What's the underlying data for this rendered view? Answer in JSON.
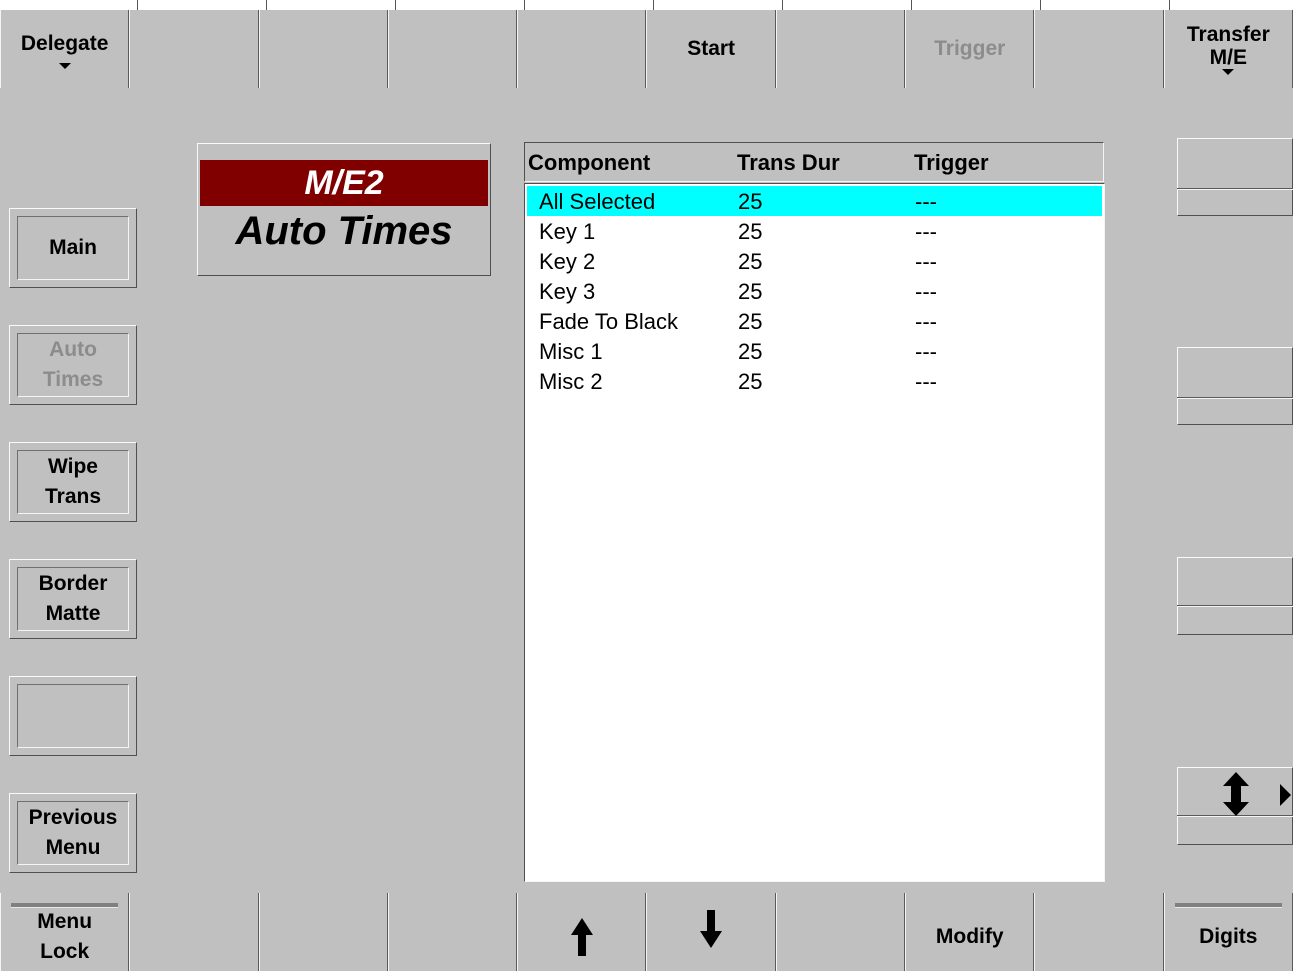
{
  "top_toolbar": [
    {
      "label": "Delegate",
      "label2": "",
      "has_dropdown": true,
      "state": "enabled"
    },
    {
      "label": "",
      "label2": "",
      "has_dropdown": false,
      "state": "enabled"
    },
    {
      "label": "",
      "label2": "",
      "has_dropdown": false,
      "state": "enabled"
    },
    {
      "label": "",
      "label2": "",
      "has_dropdown": false,
      "state": "enabled"
    },
    {
      "label": "",
      "label2": "",
      "has_dropdown": false,
      "state": "enabled"
    },
    {
      "label": "Start",
      "label2": "",
      "has_dropdown": false,
      "state": "enabled"
    },
    {
      "label": "",
      "label2": "",
      "has_dropdown": false,
      "state": "enabled"
    },
    {
      "label": "Trigger",
      "label2": "",
      "has_dropdown": false,
      "state": "disabled"
    },
    {
      "label": "",
      "label2": "",
      "has_dropdown": false,
      "state": "enabled"
    },
    {
      "label": "Transfer",
      "label2": "M/E",
      "has_dropdown": true,
      "state": "enabled"
    }
  ],
  "sidebar": [
    {
      "line1": "Main",
      "line2": "",
      "state": "enabled"
    },
    {
      "line1": "Auto",
      "line2": "Times",
      "state": "disabled"
    },
    {
      "line1": "Wipe",
      "line2": "Trans",
      "state": "enabled"
    },
    {
      "line1": "Border",
      "line2": "Matte",
      "state": "enabled"
    },
    {
      "line1": "",
      "line2": "",
      "state": "enabled"
    },
    {
      "line1": "Previous",
      "line2": "Menu",
      "state": "enabled"
    }
  ],
  "title": {
    "me": "M/E2",
    "page": "Auto Times"
  },
  "list": {
    "columns": [
      "Component",
      "Trans Dur",
      "Trigger"
    ],
    "rows": [
      {
        "component": "All Selected",
        "duration": "25",
        "trigger": "---",
        "selected": true
      },
      {
        "component": "Key 1",
        "duration": "25",
        "trigger": "---",
        "selected": false
      },
      {
        "component": "Key 2",
        "duration": "25",
        "trigger": "---",
        "selected": false
      },
      {
        "component": "Key 3",
        "duration": "25",
        "trigger": "---",
        "selected": false
      },
      {
        "component": "Fade To Black",
        "duration": "25",
        "trigger": "---",
        "selected": false
      },
      {
        "component": "Misc 1",
        "duration": "25",
        "trigger": "---",
        "selected": false
      },
      {
        "component": "Misc 2",
        "duration": "25",
        "trigger": "---",
        "selected": false
      }
    ]
  },
  "bottom_toolbar": [
    {
      "label": "Menu",
      "label2": "Lock",
      "icon": "",
      "bar": true
    },
    {
      "label": "",
      "label2": "",
      "icon": "",
      "bar": false
    },
    {
      "label": "",
      "label2": "",
      "icon": "",
      "bar": false
    },
    {
      "label": "",
      "label2": "",
      "icon": "",
      "bar": false
    },
    {
      "label": "",
      "label2": "",
      "icon": "arrow-up-icon",
      "bar": false
    },
    {
      "label": "",
      "label2": "",
      "icon": "arrow-down-icon",
      "bar": false
    },
    {
      "label": "",
      "label2": "",
      "icon": "",
      "bar": false
    },
    {
      "label": "Modify",
      "label2": "",
      "icon": "",
      "bar": false
    },
    {
      "label": "",
      "label2": "",
      "icon": "",
      "bar": false
    },
    {
      "label": "Digits",
      "label2": "",
      "icon": "",
      "bar": true
    }
  ],
  "right_panel": {
    "scroll_icon": "up-down-arrow-icon",
    "expand_icon": "triangle-right-icon"
  }
}
